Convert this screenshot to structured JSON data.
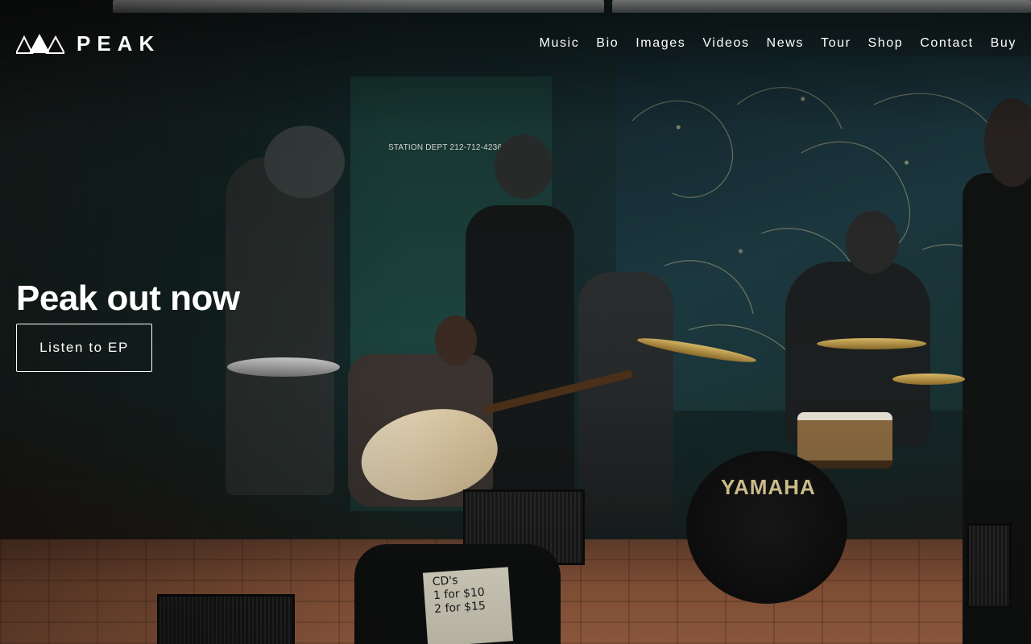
{
  "brand": {
    "name": "PEAK",
    "logo_icon": "mountain-peaks-icon"
  },
  "nav": {
    "items": [
      {
        "label": "Music"
      },
      {
        "label": "Bio"
      },
      {
        "label": "Images"
      },
      {
        "label": "Videos"
      },
      {
        "label": "News"
      },
      {
        "label": "Tour"
      },
      {
        "label": "Shop"
      },
      {
        "label": "Contact"
      },
      {
        "label": "Buy"
      }
    ]
  },
  "hero": {
    "title": "Peak out now",
    "cta_label": "Listen to EP",
    "background": {
      "door_sign": "STATION DEPT 212-712-4236",
      "drum_brand": "YAMAHA",
      "cd_sign_lines": [
        "CD's",
        "1 for $10",
        "2 for $15"
      ]
    }
  },
  "colors": {
    "text": "#ffffff",
    "overlay_dark": "#1d2220",
    "mural_teal": "#1d3a42",
    "floor_tile": "#9a5f40"
  }
}
